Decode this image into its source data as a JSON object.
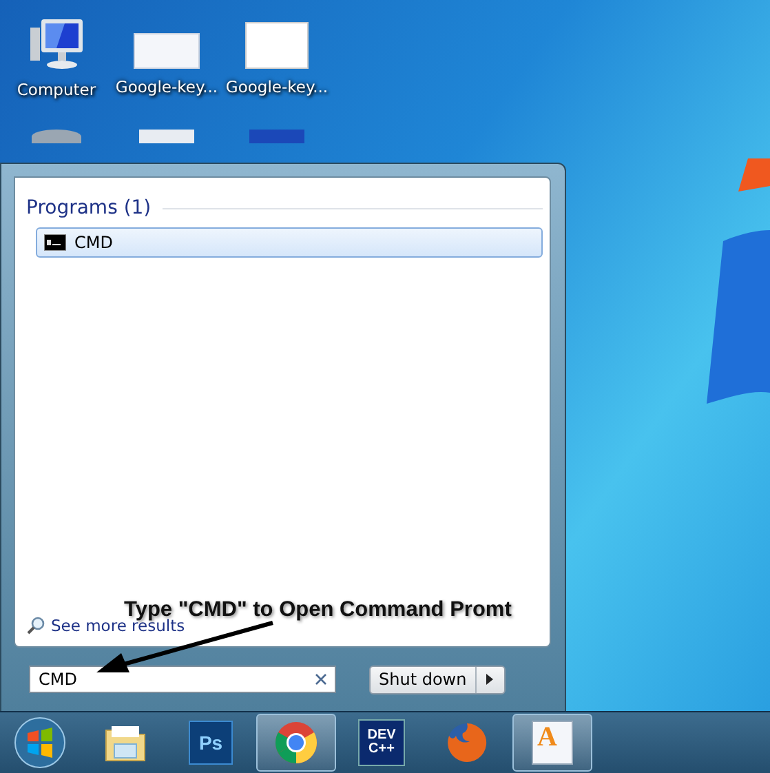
{
  "desktop_icons": [
    {
      "label": "Computer",
      "kind": "computer"
    },
    {
      "label": "Google-key...",
      "kind": "page-thumb"
    },
    {
      "label": "Google-key...",
      "kind": "image-thumb"
    }
  ],
  "start_menu": {
    "section_title": "Programs (1)",
    "results": [
      {
        "label": "CMD",
        "selected": true
      }
    ],
    "see_more": "See more results",
    "search": {
      "value": "CMD"
    },
    "shutdown": {
      "label": "Shut down"
    }
  },
  "annotation": {
    "text": "Type \"CMD\" to Open Command Promt"
  },
  "taskbar": [
    {
      "kind": "start",
      "running": false
    },
    {
      "kind": "explorer",
      "running": false
    },
    {
      "kind": "photoshop",
      "running": false,
      "logo_text": "Ps"
    },
    {
      "kind": "chrome",
      "running": true
    },
    {
      "kind": "devcpp",
      "running": false,
      "logo_text": "DEV C++"
    },
    {
      "kind": "firefox",
      "running": false
    },
    {
      "kind": "wordpad",
      "running": true,
      "logo_text": "A"
    }
  ]
}
